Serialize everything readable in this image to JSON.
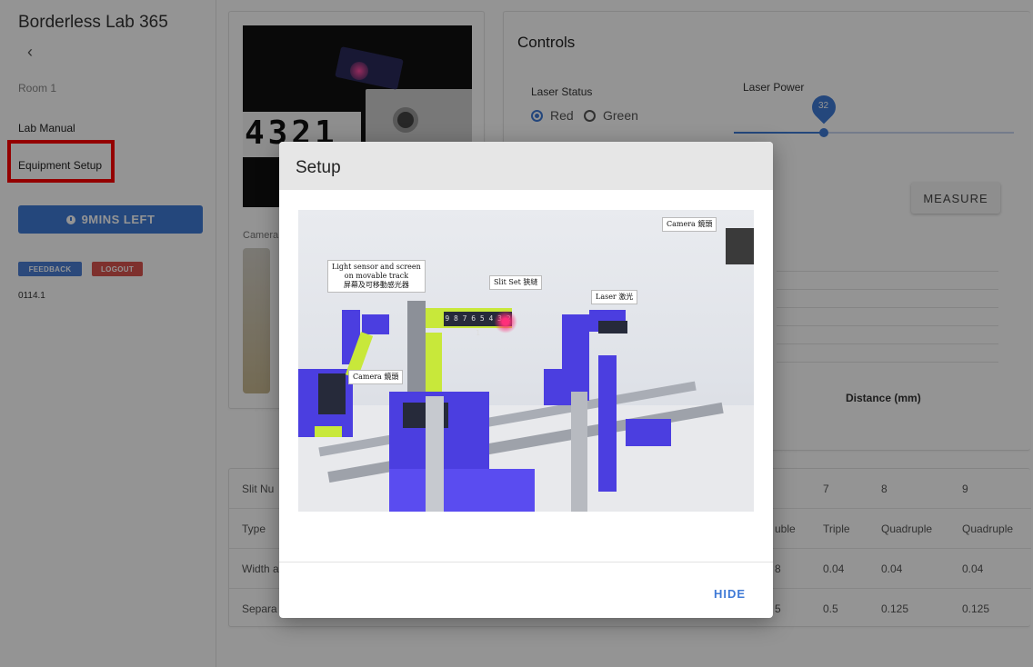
{
  "sidebar": {
    "app_title": "Borderless Lab 365",
    "back_symbol": "‹",
    "room": "Room 1",
    "nav": [
      "Lab Manual",
      "Equipment Setup"
    ],
    "timer_label": "9MINS LEFT",
    "feedback_label": "FEEDBACK",
    "logout_label": "LOGOUT",
    "version": "0114.1"
  },
  "camera_card": {
    "label": "Camera",
    "digits": "4321"
  },
  "controls": {
    "title": "Controls",
    "laser_status_label": "Laser Status",
    "options": [
      "Red",
      "Green"
    ],
    "selected": "Red",
    "laser_power_label": "Laser Power",
    "laser_power_value": "32",
    "laser_power_fraction": 0.32,
    "measure_label": "MEASURE",
    "distance_label": "Distance (mm)"
  },
  "table": {
    "rows": [
      {
        "head": "Slit Nu",
        "cells": [
          "7",
          "8",
          "9"
        ],
        "partial": ""
      },
      {
        "head": "Type",
        "cells": [
          "Triple",
          "Quadruple",
          "Quadruple"
        ],
        "partial": "uble"
      },
      {
        "head": "Width a",
        "cells": [
          "0.04",
          "0.04",
          "0.04"
        ],
        "partial": "8"
      },
      {
        "head": "Separa",
        "cells": [
          "0.5",
          "0.125",
          "0.125"
        ],
        "partial": "5"
      }
    ]
  },
  "modal": {
    "title": "Setup",
    "hide_label": "HIDE",
    "photo_labels": {
      "camera_top": "Camera 鏡頭",
      "light_sensor": [
        "Light sensor and screen",
        "on movable track",
        "屏幕及可移動感光器"
      ],
      "slit_set": "Slit Set 狹縫",
      "laser": "Laser 激光",
      "camera_bottom": "Camera 鏡頭",
      "slit_numbers": "9 8 7 6 5 4 3 2 1"
    }
  },
  "colors": {
    "accent": "#3f7ad6",
    "logout": "#d9534f",
    "highlight": "#ff0000"
  }
}
